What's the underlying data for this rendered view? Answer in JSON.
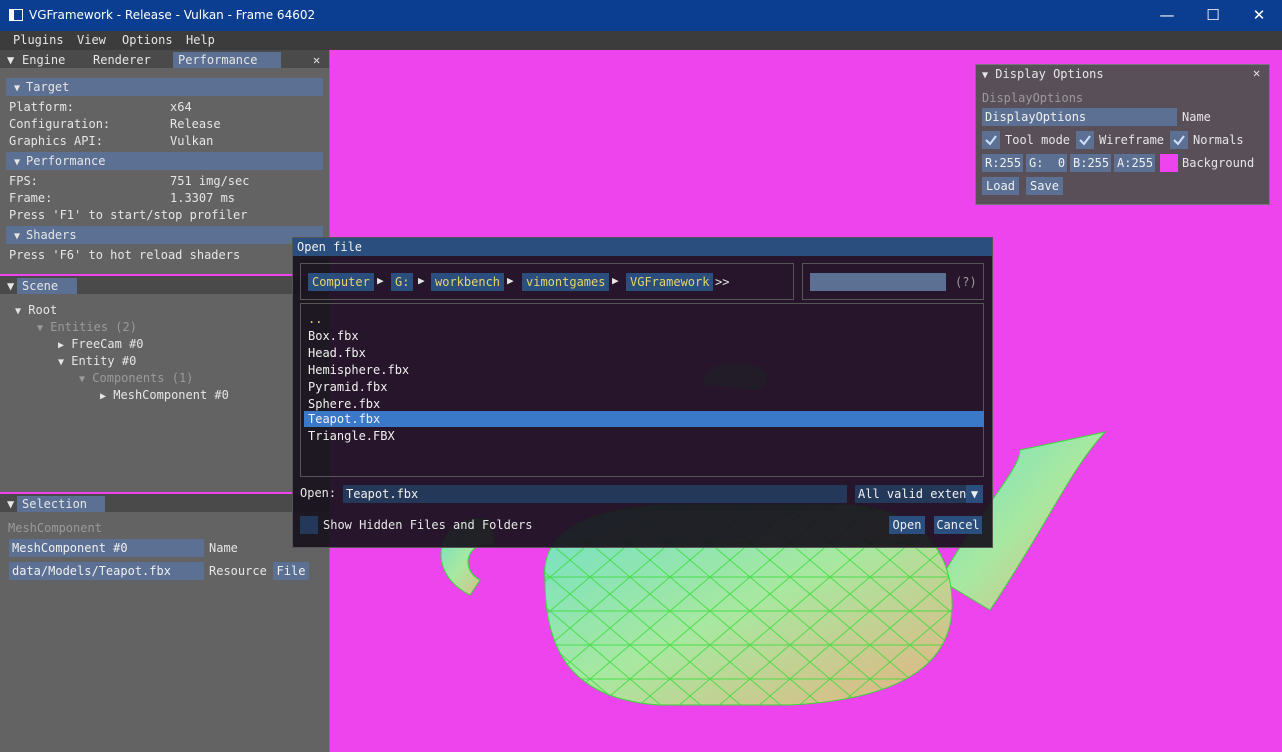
{
  "window": {
    "title": "VGFramework - Release - Vulkan - Frame 64602"
  },
  "menubar": {
    "items": [
      "Plugins",
      "View",
      "Options",
      "Help"
    ]
  },
  "left_top_panel": {
    "tabs": [
      "Engine",
      "Renderer",
      "Performance"
    ],
    "target": {
      "header": "Target",
      "rows": [
        {
          "label": "Platform:",
          "value": "x64"
        },
        {
          "label": "Configuration:",
          "value": "Release"
        },
        {
          "label": "Graphics API:",
          "value": "Vulkan"
        }
      ]
    },
    "performance": {
      "header": "Performance",
      "rows": [
        {
          "label": "FPS:",
          "value": "751 img/sec"
        },
        {
          "label": "Frame:",
          "value": "1.3307 ms"
        }
      ],
      "hint": "Press 'F1' to start/stop profiler"
    },
    "shaders": {
      "header": "Shaders",
      "hint": "Press 'F6' to hot reload shaders"
    }
  },
  "scene_panel": {
    "tab": "Scene",
    "tree": [
      "Root",
      "Entities (2)",
      "FreeCam #0",
      "Entity #0",
      "Components (1)",
      "MeshComponent #0"
    ]
  },
  "selection_panel": {
    "tab": "Selection",
    "type_label": "MeshComponent",
    "name_value": "MeshComponent #0",
    "name_label": "Name",
    "resource_value": "data/Models/Teapot.fbx",
    "resource_label": "Resource",
    "file_button": "File"
  },
  "display_options": {
    "title": "Display Options",
    "section_label": "DisplayOptions",
    "name_value": "DisplayOptions",
    "name_label": "Name",
    "tool_mode": "Tool mode",
    "wireframe": "Wireframe",
    "normals": "Normals",
    "r": "R:255",
    "g": "G:  0",
    "b": "B:255",
    "a": "A:255",
    "background_label": "Background",
    "background_color": "#ee44ee",
    "load": "Load",
    "save": "Save"
  },
  "open_dialog": {
    "title": "Open file",
    "breadcrumbs": [
      "Computer",
      "G:",
      "workbench",
      "vimontgames",
      "VGFramework"
    ],
    "more": ">>",
    "help": "(?)",
    "files": [
      "..",
      "Box.fbx",
      "Head.fbx",
      "Hemisphere.fbx",
      "Pyramid.fbx",
      "Sphere.fbx",
      "Teapot.fbx",
      "Triangle.FBX"
    ],
    "selected_file": "Teapot.fbx",
    "open_label": "Open:",
    "filename": "Teapot.fbx",
    "filter": "All valid exten",
    "show_hidden": "Show Hidden Files and Folders",
    "open_button": "Open",
    "cancel_button": "Cancel"
  }
}
